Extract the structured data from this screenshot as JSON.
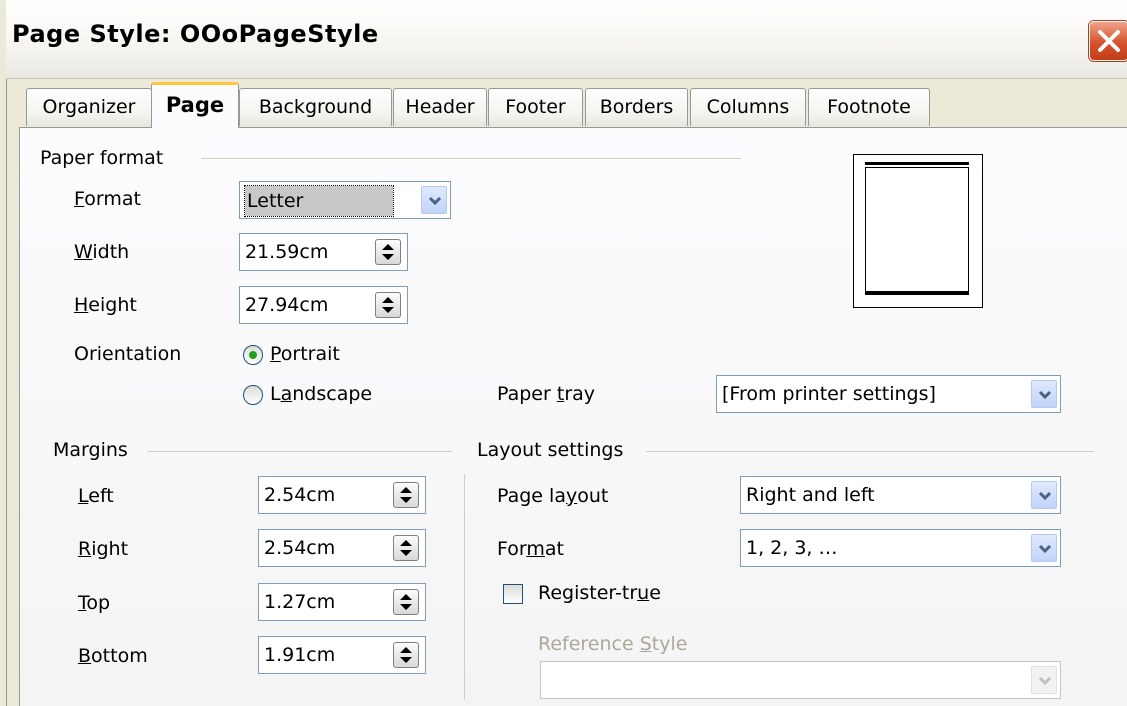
{
  "window": {
    "title": "Page Style: OOoPageStyle"
  },
  "tabs": [
    {
      "label": "Organizer"
    },
    {
      "label": "Page"
    },
    {
      "label": "Background"
    },
    {
      "label": "Header"
    },
    {
      "label": "Footer"
    },
    {
      "label": "Borders"
    },
    {
      "label": "Columns"
    },
    {
      "label": "Footnote"
    }
  ],
  "paper_format": {
    "section_label": "Paper format",
    "format_label_ul": "F",
    "format_label_rest": "ormat",
    "format_value": "Letter",
    "width_label_ul": "W",
    "width_label_rest": "idth",
    "width_value": "21.59cm",
    "height_label_ul": "H",
    "height_label_rest": "eight",
    "height_value": "27.94cm",
    "orientation_label": "Orientation",
    "portrait_ul": "P",
    "portrait_rest": "ortrait",
    "landscape_pre": "L",
    "landscape_ul": "a",
    "landscape_rest": "ndscape",
    "orientation_selected": "Portrait",
    "paper_tray_pre": "Paper ",
    "paper_tray_ul": "t",
    "paper_tray_rest": "ray",
    "paper_tray_value": "[From printer settings]"
  },
  "margins": {
    "section_label": "Margins",
    "left_ul": "L",
    "left_rest": "eft",
    "left_value": "2.54cm",
    "right_ul": "R",
    "right_rest": "ight",
    "right_value": "2.54cm",
    "top_ul": "T",
    "top_rest": "op",
    "top_value": "1.27cm",
    "bottom_ul": "B",
    "bottom_rest": "ottom",
    "bottom_value": "1.91cm"
  },
  "layout_settings": {
    "section_label": "Layout settings",
    "page_layout_pre": "Page la",
    "page_layout_ul": "y",
    "page_layout_rest": "out",
    "page_layout_value": "Right and left",
    "format_pre": "For",
    "format_ul": "m",
    "format_rest": "at",
    "format_value": "1, 2, 3, …",
    "register_pre": "Register-tr",
    "register_ul": "u",
    "register_rest": "e",
    "register_checked": false,
    "reference_pre": "Reference ",
    "reference_ul": "S",
    "reference_rest": "tyle",
    "reference_value": ""
  },
  "icons": {
    "close": "close-icon",
    "dropdown": "chevron-down-icon",
    "spin": "spin-updown-icon"
  },
  "colors": {
    "close_button": "#d4542e",
    "active_tab_accent": "#ffc73c",
    "radio_dot": "#21a121"
  }
}
